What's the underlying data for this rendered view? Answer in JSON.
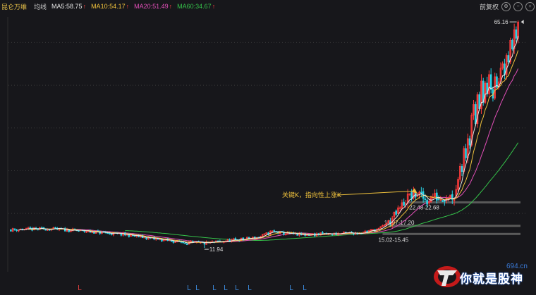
{
  "header": {
    "stock_name": "昆仑万维",
    "indicator": "均线",
    "ma_values": [
      {
        "label": "MA5:58.75",
        "color": "#e8e8e8"
      },
      {
        "label": "MA10:54.17",
        "color": "#f0c23c"
      },
      {
        "label": "MA20:51.49",
        "color": "#e24fb8"
      },
      {
        "label": "MA60:34.67",
        "color": "#35c24a"
      }
    ],
    "ma_arrow": "↑",
    "adjust_label": "前复权",
    "settings_icon": "gear-icon",
    "minus_icon": "minus-icon",
    "plus_icon": "plus-icon"
  },
  "colors": {
    "up": "#ff3b3b",
    "down": "#29d3e6",
    "ma5": "#e8e8e8",
    "ma10": "#f0c23c",
    "ma20": "#e24fb8",
    "ma60": "#35c24a",
    "annotation": "#f0c23c",
    "zone": "#5a5a5a",
    "signal": "#3d8de0",
    "signal_red": "#e24040",
    "grid": "#3a3a3a"
  },
  "chart_data": {
    "type": "candlestick",
    "ylim": [
      8,
      66
    ],
    "y_ticks": [
      20,
      30,
      40,
      50,
      60
    ],
    "y_tick_labels": [
      "",
      "",
      "",
      "",
      ""
    ],
    "high_marker": "65.16",
    "low_marker": "11.94",
    "annotation": "关键K，指向性上涨K",
    "zones": [
      {
        "label": "22.48-22.68",
        "y": 22.6
      },
      {
        "label": "16.97-17.20",
        "y": 17.1
      },
      {
        "label": "15.02-15.45",
        "y": 15.2
      }
    ],
    "signals": [
      {
        "text": "L",
        "color": "red"
      },
      {
        "text": "L",
        "color": "blue"
      },
      {
        "text": "L",
        "color": "blue"
      },
      {
        "text": "L",
        "color": "blue"
      },
      {
        "text": "L",
        "color": "blue"
      },
      {
        "text": "L",
        "color": "blue"
      },
      {
        "text": "L",
        "color": "blue"
      },
      {
        "text": "L",
        "color": "blue"
      },
      {
        "text": "L",
        "color": "blue"
      }
    ]
  },
  "watermark": {
    "site": "694.cn",
    "text": "你就是股神"
  }
}
